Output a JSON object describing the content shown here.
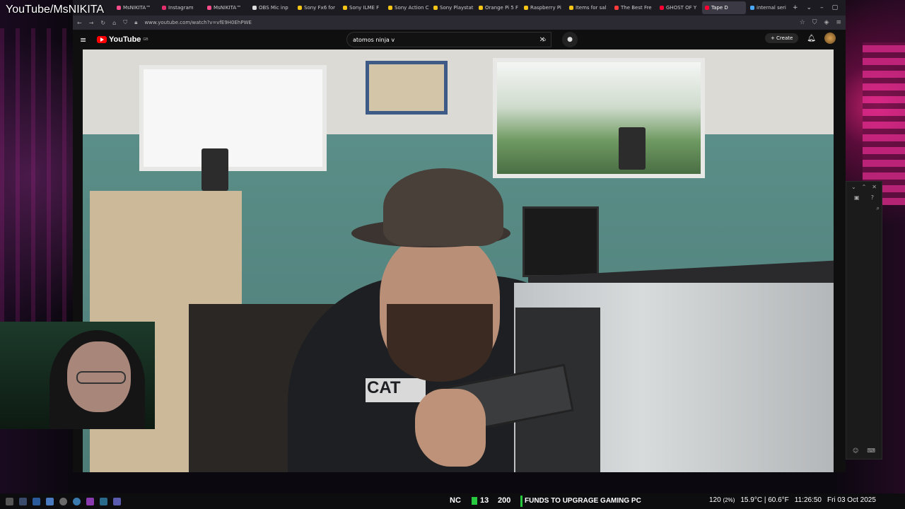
{
  "overlay_title": "YouTube/MsNIKITA",
  "tabs": [
    {
      "label": "MsNIKITA™",
      "color": "#ff4e8a",
      "active": false
    },
    {
      "label": "Instagram",
      "color": "#e1306c",
      "active": false
    },
    {
      "label": "MsNIKITA™",
      "color": "#ff4e8a",
      "active": false
    },
    {
      "label": "OBS Mic inp",
      "color": "#dddddd",
      "active": false
    },
    {
      "label": "Sony Fx6 for",
      "color": "#f5c518",
      "active": false
    },
    {
      "label": "Sony ILME F",
      "color": "#f5c518",
      "active": false
    },
    {
      "label": "Sony Action C",
      "color": "#f5c518",
      "active": false
    },
    {
      "label": "Sony Playstat",
      "color": "#f5c518",
      "active": false
    },
    {
      "label": "Orange Pi 5 F",
      "color": "#f5c518",
      "active": false
    },
    {
      "label": "Raspberry Pi",
      "color": "#f5c518",
      "active": false
    },
    {
      "label": "Items for sal",
      "color": "#f5c518",
      "active": false
    },
    {
      "label": "The Best Fre",
      "color": "#ff3b3b",
      "active": false
    },
    {
      "label": "GHOST OF Y",
      "color": "#ff0033",
      "active": false
    },
    {
      "label": "Tape D",
      "color": "#ff0033",
      "active": true
    },
    {
      "label": "internal seri",
      "color": "#4aa8ff",
      "active": false
    }
  ],
  "url": "www.youtube.com/watch?v=vfE9H0EhPWE",
  "youtube": {
    "logo": "YouTube",
    "logo_sup": "GB",
    "search_value": "atomos ninja v",
    "create_label": "Create"
  },
  "video": {
    "shirt_text": "CAT"
  },
  "taskbar": {
    "nc": "NC",
    "subs": "13",
    "views": "200",
    "goal": "FUNDS TO UPGRAGE GAMING PC",
    "fps": "120",
    "fps_pct": "(2%)",
    "temp": "15.9°C | 60.6°F",
    "time": "11:26:50",
    "date": "Fri 03 Oct 2025"
  },
  "colors": {
    "accent_red": "#ff0000",
    "green_badge": "#27c93f",
    "neon_pink": "#e02b8e"
  }
}
